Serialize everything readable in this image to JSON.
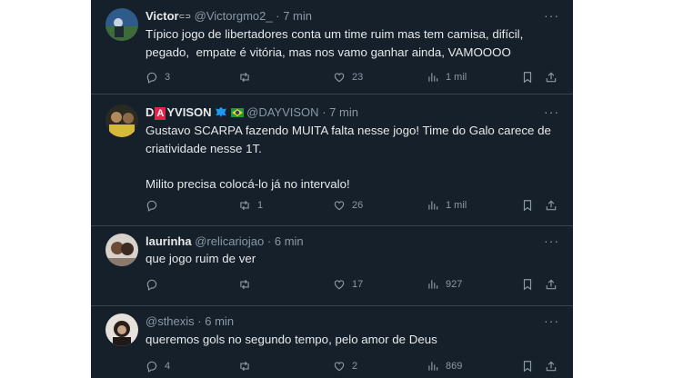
{
  "posts": [
    {
      "name": "Victor",
      "name_tag": "",
      "handle": "@Victorgmo2_",
      "sep": "·",
      "time": "7 min",
      "text": "Típico jogo de libertadores conta um time ruim mas tem camisa, difícil, pegado,  empate é vitória, mas nos vamo ganhar ainda, VAMOOOO",
      "replies": "3",
      "reposts": "",
      "likes": "23",
      "views": "1 mil"
    },
    {
      "name_prefix": "D",
      "name_logo": "A",
      "name": "YVISON",
      "handle": "@DAYVISON",
      "sep": "·",
      "time": "7 min",
      "text": "Gustavo SCARPA fazendo MUITA falta nesse jogo! Time do Galo carece de criatividade nesse 1T.\n\nMilito precisa colocá-lo já no intervalo!",
      "replies": "",
      "reposts": "1",
      "likes": "26",
      "views": "1 mil"
    },
    {
      "name": "laurinha",
      "handle": "@relicariojao",
      "sep": "·",
      "time": "6 min",
      "text": "que jogo ruim de ver",
      "replies": "",
      "reposts": "",
      "likes": "17",
      "views": "927"
    },
    {
      "name": "",
      "handle": "@sthexis",
      "sep": "·",
      "time": "6 min",
      "text": "queremos gols no segundo tempo, pelo amor de Deus",
      "replies": "4",
      "reposts": "",
      "likes": "2",
      "views": "869"
    }
  ],
  "colors": {
    "background": "#15202b",
    "text": "#e7e9ea",
    "muted": "#8b98a5",
    "divider": "#38444d",
    "verified": "#1d9bf0"
  },
  "icons": [
    "reply-icon",
    "repost-icon",
    "like-icon",
    "views-icon",
    "bookmark-icon",
    "share-icon",
    "more-icon",
    "verified-icon",
    "brazil-flag-icon"
  ]
}
